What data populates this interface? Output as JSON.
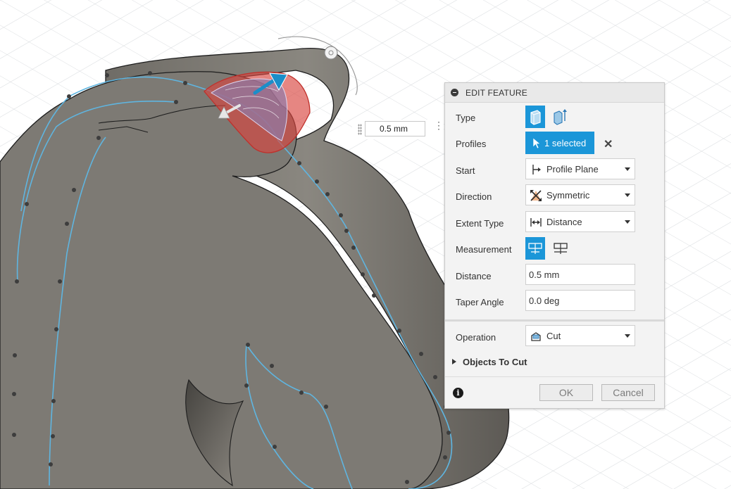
{
  "canvas": {
    "inline_distance_value": "0.5 mm"
  },
  "dialog": {
    "title": "EDIT FEATURE",
    "rows": {
      "type": {
        "label": "Type"
      },
      "profiles": {
        "label": "Profiles",
        "value": "1 selected"
      },
      "start": {
        "label": "Start",
        "value": "Profile Plane"
      },
      "direction": {
        "label": "Direction",
        "value": "Symmetric"
      },
      "extent_type": {
        "label": "Extent Type",
        "value": "Distance"
      },
      "measurement": {
        "label": "Measurement"
      },
      "distance": {
        "label": "Distance",
        "value": "0.5 mm"
      },
      "taper_angle": {
        "label": "Taper Angle",
        "value": "0.0 deg"
      },
      "operation": {
        "label": "Operation",
        "value": "Cut"
      }
    },
    "objects_to_cut": "Objects To Cut",
    "ok_label": "OK",
    "cancel_label": "Cancel",
    "colors": {
      "accent": "#1b96d8",
      "profile_selection": "#d9453f",
      "sketch_line": "#5fb5e0"
    }
  }
}
